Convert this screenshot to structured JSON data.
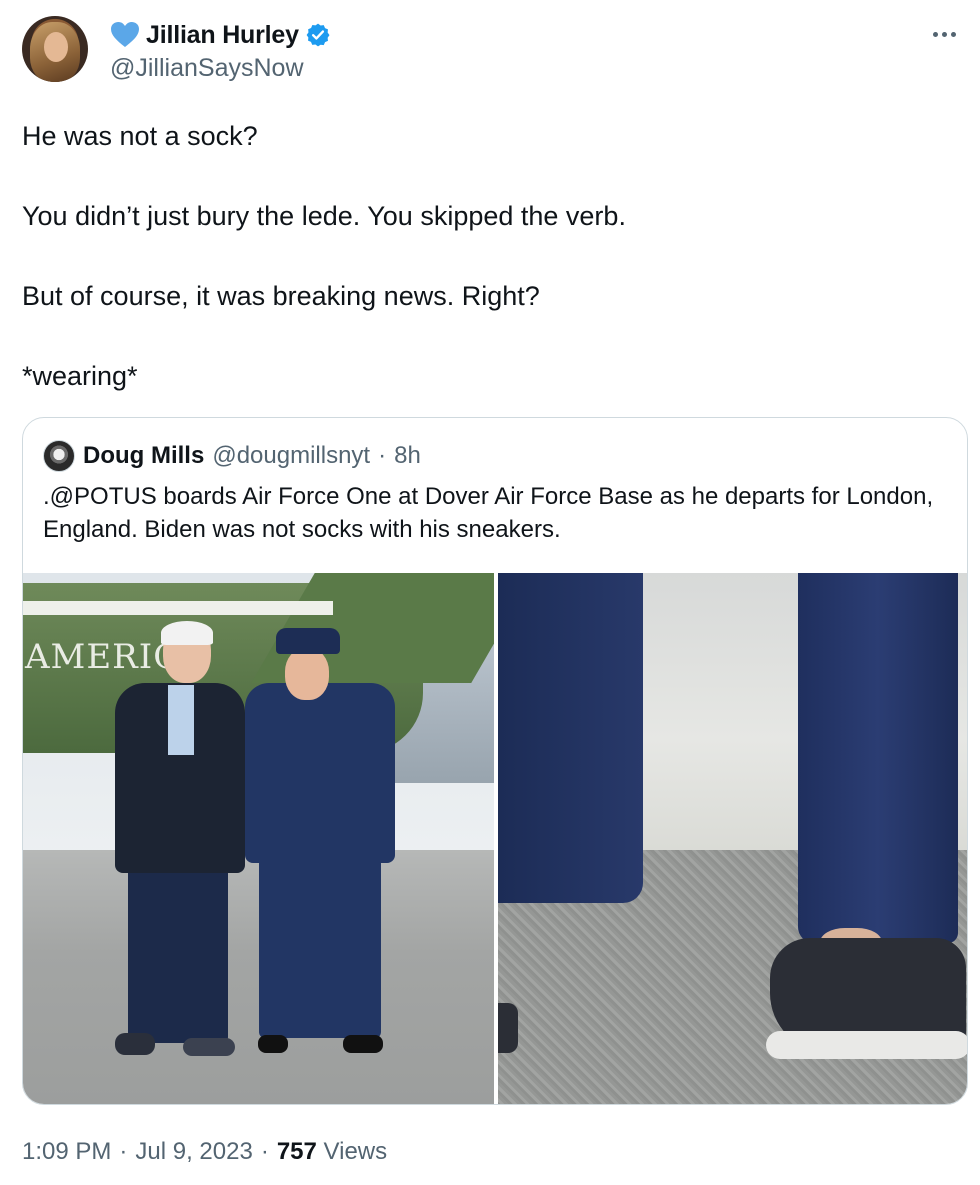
{
  "author": {
    "display_name": "Jillian Hurley",
    "handle": "@JillianSaysNow",
    "emoji_icon": "blue-heart-icon",
    "verified_icon": "verified-badge-icon",
    "verified_color": "#1d9bf0",
    "heart_color": "#5ba7e8"
  },
  "tweet": {
    "lines": [
      "He was not a sock?",
      "You didn’t just bury the lede. You skipped the verb.",
      "But of course, it was breaking news. Right?",
      "*wearing*"
    ]
  },
  "quoted_tweet": {
    "display_name": "Doug Mills",
    "handle": "@dougmillsnyt",
    "separator": "·",
    "time": "8h",
    "text": ".@POTUS boards Air Force One at Dover Air Force Base as he departs for London, England. Biden was not socks with his sneakers.",
    "photo_left_text": "AMERIC"
  },
  "meta": {
    "time": "1:09 PM",
    "sep1": "·",
    "date": "Jul 9, 2023",
    "sep2": "·",
    "views_count": "757",
    "views_label": "Views"
  },
  "colors": {
    "text_primary": "#0f1419",
    "text_secondary": "#536471",
    "border": "#cfd9de"
  }
}
